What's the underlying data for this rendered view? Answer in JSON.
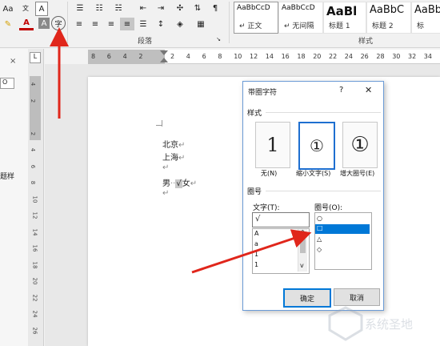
{
  "ribbon": {
    "aa_label": "Aa",
    "font_color_label": "A",
    "shade_label": "A",
    "enclose_label": "字",
    "wen_label": "文",
    "paragraph_group": "段落",
    "styles_group": "样式",
    "styles": [
      {
        "sample": "AaBbCcD",
        "name": "↵ 正文"
      },
      {
        "sample": "AaBbCcD",
        "name": "↵ 无间隔"
      },
      {
        "sample": "AaBl",
        "name": "标题 1"
      },
      {
        "sample": "AaBbC",
        "name": "标题 2"
      },
      {
        "sample": "AaBb",
        "name": "标"
      }
    ]
  },
  "left_panel": {
    "search_label": "O",
    "style_label": "题样",
    "close_label": "×"
  },
  "hruler_ticks": [
    "8",
    "6",
    "4",
    "2",
    "",
    "2",
    "4",
    "6",
    "8",
    "10",
    "12",
    "14",
    "16",
    "18",
    "20",
    "22",
    "24",
    "26",
    "28",
    "30",
    "32",
    "34"
  ],
  "vruler_ticks": [
    "4",
    "2",
    "",
    "2",
    "4",
    "6",
    "8",
    "10",
    "12",
    "14",
    "16",
    "18",
    "20",
    "22",
    "24",
    "26"
  ],
  "document": {
    "line1": "北京",
    "line2": "上海",
    "line4_prefix": "男",
    "line4_mark": "√",
    "line4_suffix": "女",
    "pilcrow": "↵"
  },
  "dialog": {
    "title": "带圈字符",
    "help": "?",
    "close": "✕",
    "style_section": "样式",
    "styles": [
      {
        "glyph": "1",
        "label": "无(N)"
      },
      {
        "glyph": "①",
        "label": "缩小文字(S)"
      },
      {
        "glyph": "①",
        "label": "增大圈号(E)"
      }
    ],
    "enclosure_section": "圈号",
    "text_label": "文字(T):",
    "text_value": "√",
    "text_list": [
      "A",
      "a",
      "1",
      "1"
    ],
    "shape_label": "圈号(O):",
    "shape_list": [
      "○",
      "□",
      "△",
      "◇"
    ],
    "ok": "确定",
    "cancel": "取消"
  },
  "watermark": {
    "text": "系统圣地"
  },
  "colors": {
    "accent": "#2b5797",
    "arrow": "#e0261b",
    "selection": "#0078d7"
  }
}
